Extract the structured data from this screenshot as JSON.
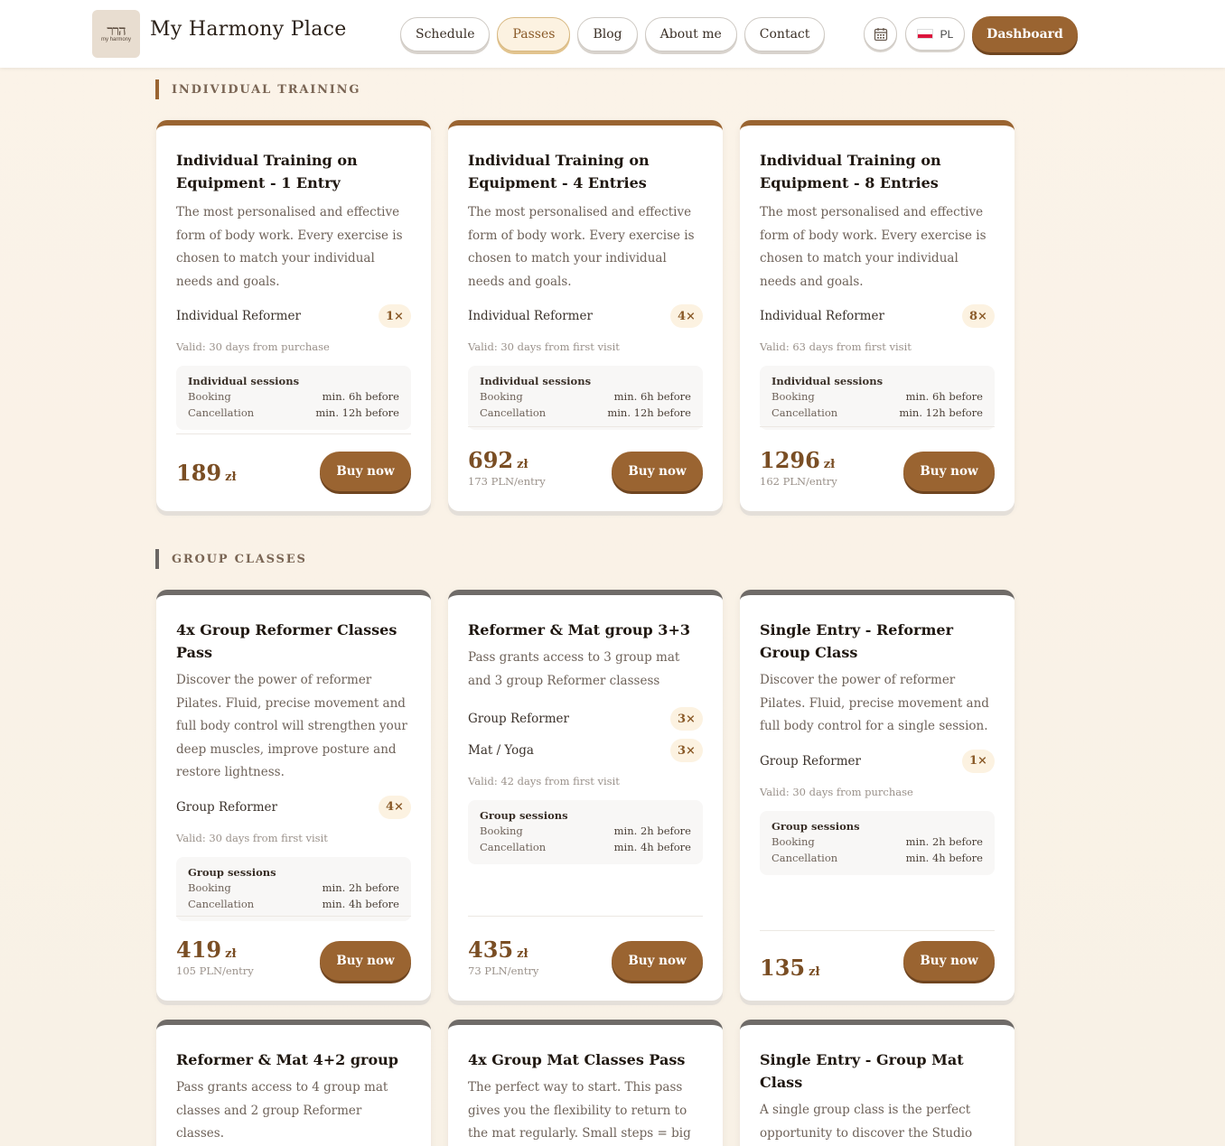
{
  "header": {
    "logo_glyph": "הרר",
    "logo_small": "my harmony",
    "brand": "My Harmony Place",
    "nav": [
      {
        "label": "Schedule"
      },
      {
        "label": "Passes"
      },
      {
        "label": "Blog"
      },
      {
        "label": "About me"
      },
      {
        "label": "Contact"
      }
    ],
    "active_nav": "Passes",
    "lang_label": "PL",
    "dashboard_label": "Dashboard",
    "calendar_icon": "calendar-icon",
    "flag_colors": [
      "#ffffff",
      "#dc143c"
    ]
  },
  "colors": {
    "accent": "#9a6431",
    "grey_accent": "#6f6b68",
    "badge_bg": "#fcf2e1"
  },
  "sections": [
    {
      "title": "INDIVIDUAL TRAINING",
      "cards": [
        {
          "title": "Individual Training on Equipment - 1 Entry",
          "desc": "The most personalised and effective form of body work. Every exercise is chosen to match your individual needs and goals.",
          "features": [
            {
              "name": "Individual Reformer",
              "count": "1×"
            }
          ],
          "valid": "Valid: 30 days from purchase",
          "rules_title": "Individual sessions",
          "booking_label": "Booking",
          "booking_value": "min. 6h before",
          "cancel_label": "Cancellation",
          "cancel_value": "min. 12h before",
          "price": "189",
          "currency": "zł",
          "per_entry": "",
          "buy_label": "Buy now"
        },
        {
          "title": "Individual Training on Equipment - 4 Entries",
          "desc": "The most personalised and effective form of body work. Every exercise is chosen to match your individual needs and goals.",
          "features": [
            {
              "name": "Individual Reformer",
              "count": "4×"
            }
          ],
          "valid": "Valid: 30 days from first visit",
          "rules_title": "Individual sessions",
          "booking_label": "Booking",
          "booking_value": "min. 6h before",
          "cancel_label": "Cancellation",
          "cancel_value": "min. 12h before",
          "price": "692",
          "currency": "zł",
          "per_entry": "173 PLN/entry",
          "buy_label": "Buy now"
        },
        {
          "title": "Individual Training on Equipment - 8 Entries",
          "desc": "The most personalised and effective form of body work. Every exercise is chosen to match your individual needs and goals.",
          "features": [
            {
              "name": "Individual Reformer",
              "count": "8×"
            }
          ],
          "valid": "Valid: 63 days from first visit",
          "rules_title": "Individual sessions",
          "booking_label": "Booking",
          "booking_value": "min. 6h before",
          "cancel_label": "Cancellation",
          "cancel_value": "min. 12h before",
          "price": "1296",
          "currency": "zł",
          "per_entry": "162 PLN/entry",
          "buy_label": "Buy now"
        }
      ]
    },
    {
      "title": "GROUP CLASSES",
      "cards": [
        {
          "title": "4x Group Reformer Classes Pass",
          "desc": "Discover the power of reformer Pilates. Fluid, precise movement and full body control will strengthen your deep muscles, improve posture and restore lightness.",
          "features": [
            {
              "name": "Group Reformer",
              "count": "4×"
            }
          ],
          "valid": "Valid: 30 days from first visit",
          "rules_title": "Group sessions",
          "booking_label": "Booking",
          "booking_value": "min. 2h before",
          "cancel_label": "Cancellation",
          "cancel_value": "min. 4h before",
          "price": "419",
          "currency": "zł",
          "per_entry": "105 PLN/entry",
          "buy_label": "Buy now"
        },
        {
          "title": "Reformer & Mat group 3+3",
          "desc": "Pass grants access to 3 group mat and 3 group Reformer classess",
          "features": [
            {
              "name": "Group Reformer",
              "count": "3×"
            },
            {
              "name": "Mat / Yoga",
              "count": "3×"
            }
          ],
          "valid": "Valid: 42 days from first visit",
          "rules_title": "Group sessions",
          "booking_label": "Booking",
          "booking_value": "min. 2h before",
          "cancel_label": "Cancellation",
          "cancel_value": "min. 4h before",
          "price": "435",
          "currency": "zł",
          "per_entry": "73 PLN/entry",
          "buy_label": "Buy now"
        },
        {
          "title": "Single Entry - Reformer Group Class",
          "desc": "Discover the power of reformer Pilates. Fluid, precise movement and full body control for a single session.",
          "features": [
            {
              "name": "Group Reformer",
              "count": "1×"
            }
          ],
          "valid": "Valid: 30 days from purchase",
          "rules_title": "Group sessions",
          "booking_label": "Booking",
          "booking_value": "min. 2h before",
          "cancel_label": "Cancellation",
          "cancel_value": "min. 4h before",
          "price": "135",
          "currency": "zł",
          "per_entry": "",
          "buy_label": "Buy now"
        },
        {
          "title": "Reformer & Mat 4+2 group",
          "desc": "Pass grants access to 4 group mat classes and 2 group Reformer classes."
        },
        {
          "title": "4x Group Mat Classes Pass",
          "desc": "The perfect way to start. This pass gives you the flexibility to return to the mat regularly. Small steps = big results."
        },
        {
          "title": "Single Entry - Group Mat Class",
          "desc": "A single group class is the perfect opportunity to discover the Studio and explore different training styles."
        }
      ]
    }
  ]
}
